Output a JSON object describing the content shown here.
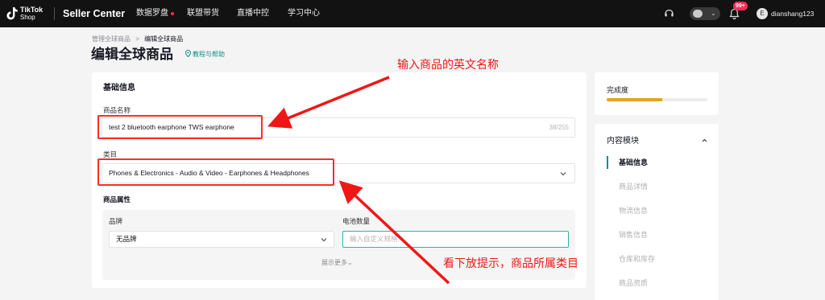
{
  "topbar": {
    "logo_line1": "TikTok",
    "logo_line2": "Shop",
    "brand": "Seller Center",
    "nav": [
      "数据罗盘",
      "联盟带货",
      "直播中控",
      "学习中心"
    ],
    "notification_badge": "99+",
    "username": "dianshang123",
    "avatar_letter": "E"
  },
  "header": {
    "breadcrumb_parent": "管理全球商品",
    "breadcrumb_sep": ">",
    "breadcrumb_current": "编辑全球商品",
    "title": "编辑全球商品",
    "tutorial_link": "教程与帮助"
  },
  "form": {
    "section_title": "基础信息",
    "name_label": "商品名称",
    "name_value": "test 2 bluetooth earphone TWS earphone",
    "name_counter": "38/255",
    "category_label": "类目",
    "category_value": "Phones & Electronics - Audio & Video - Earphones & Headphones",
    "attributes_title": "商品属性",
    "brand_label": "品牌",
    "brand_value": "无品牌",
    "battery_label": "电池数量",
    "battery_placeholder": "输入自定义规格",
    "show_more": "展示更多"
  },
  "side": {
    "completion_label": "完成度",
    "completion_fraction": 0.55,
    "modules_title": "内容模块",
    "modules": [
      "基础信息",
      "商品详情",
      "物流信息",
      "销售信息",
      "仓库和库存",
      "商品资质"
    ]
  },
  "annotations": {
    "top_note": "输入商品的英文名称",
    "bottom_note": "看下放提示，商品所属类目"
  },
  "colors": {
    "accent": "#0e8e87",
    "annotation": "#ff2b2b",
    "progress": "#e3a323",
    "topbar": "#121212"
  }
}
